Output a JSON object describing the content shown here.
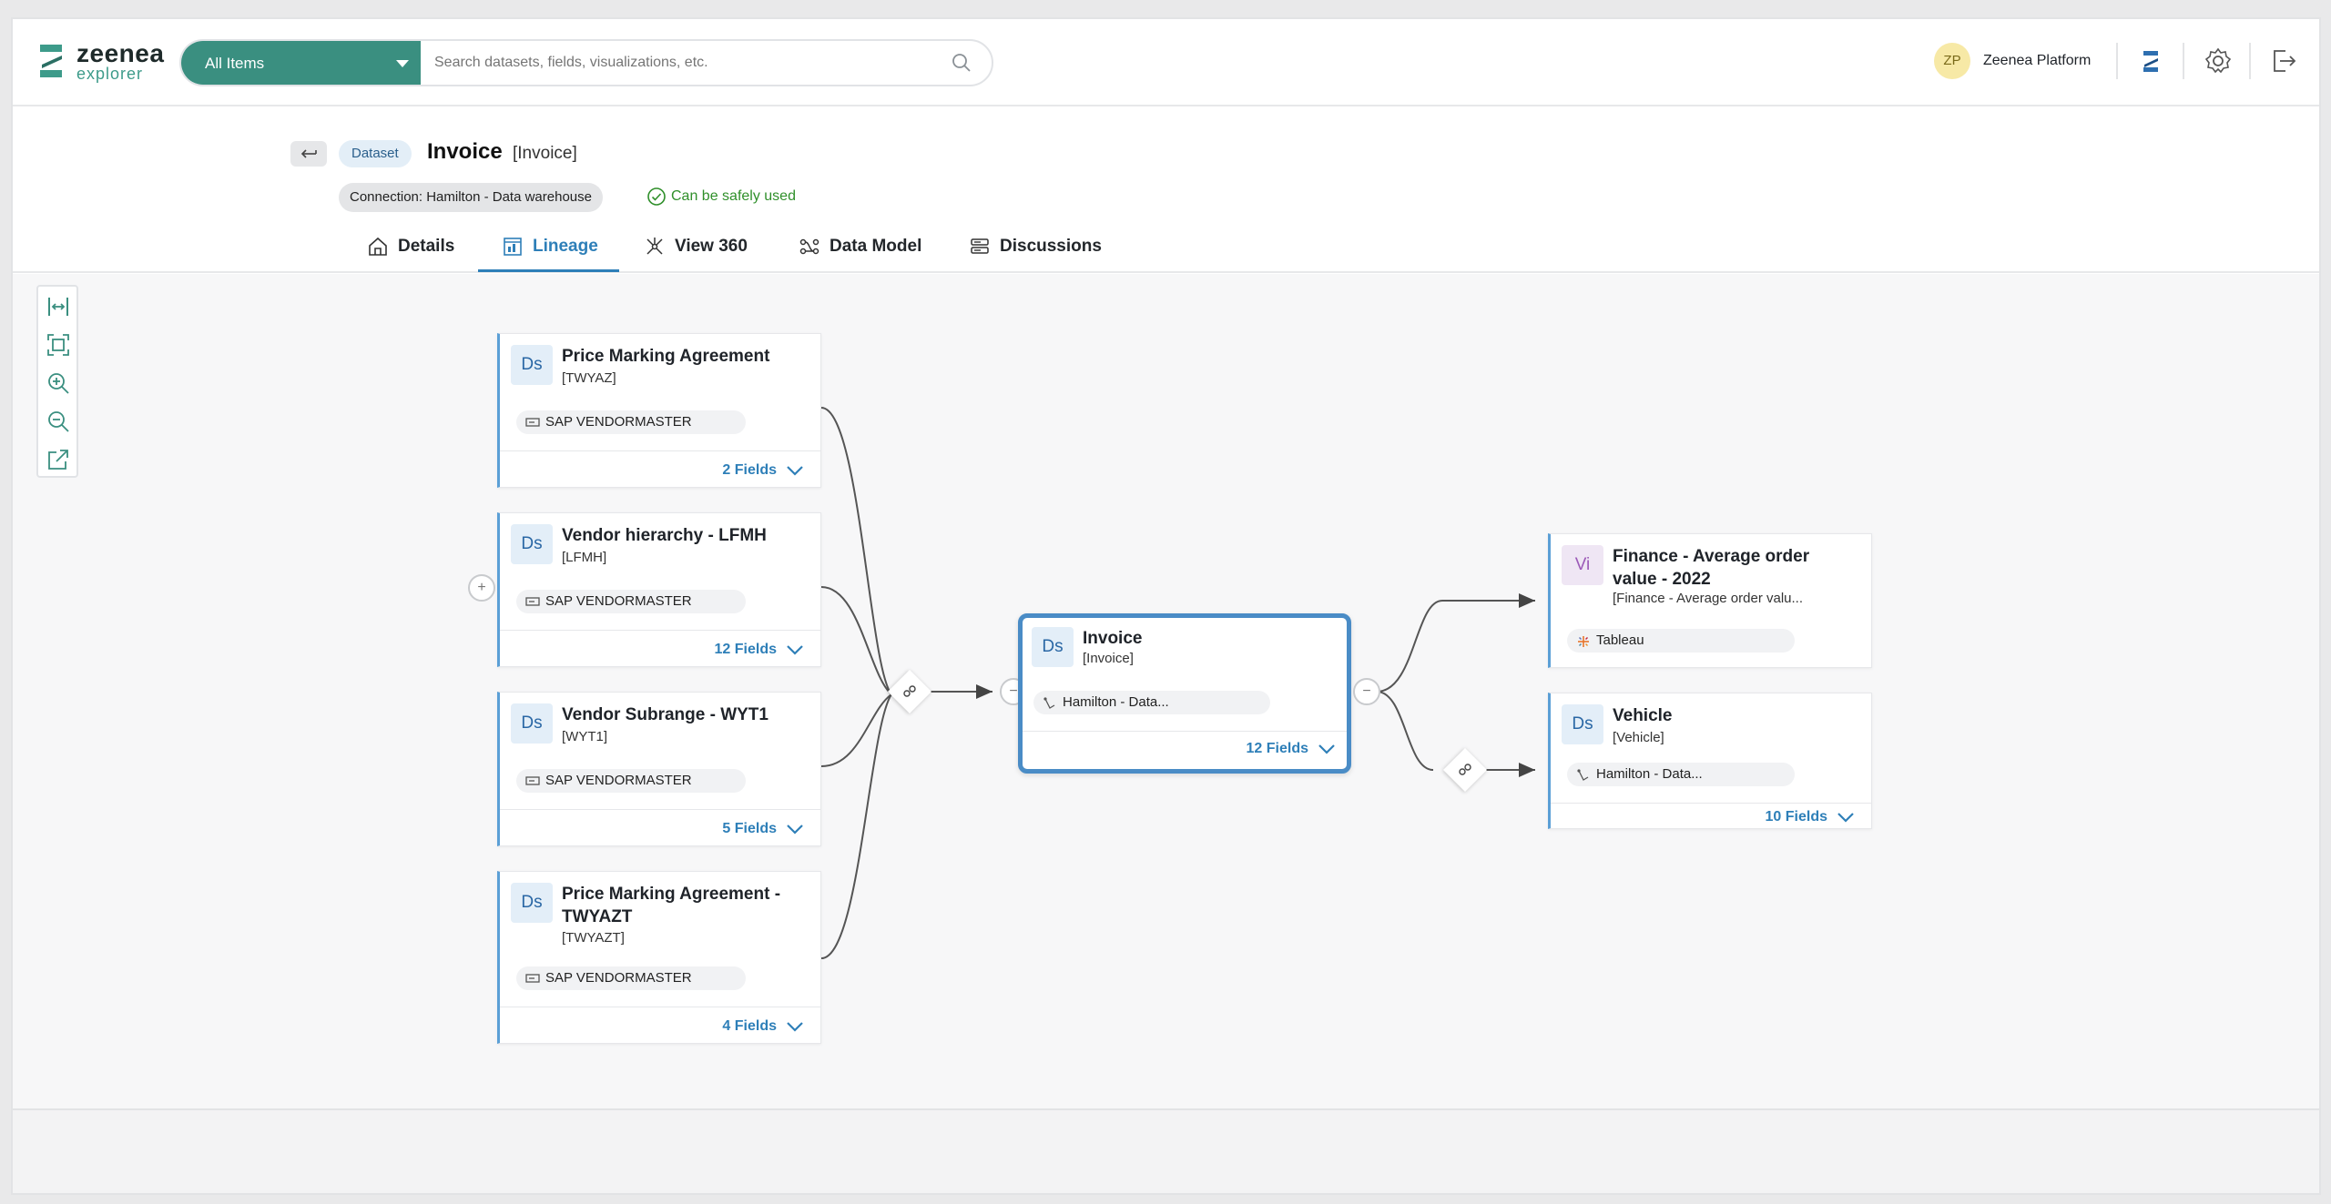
{
  "app": {
    "logo_primary": "zeenea",
    "logo_secondary": "explorer",
    "brand_color": "#3a8f80",
    "accent_color": "#2e7fb8"
  },
  "search": {
    "scope": "All Items",
    "placeholder": "Search datasets, fields, visualizations, etc."
  },
  "user": {
    "initials": "ZP",
    "name": "Zeenea Platform"
  },
  "toolbar_icons": [
    "zeenea-studio-icon",
    "settings-icon",
    "logout-icon"
  ],
  "header": {
    "type_chip": "Dataset",
    "title": "Invoice",
    "subtitle": "[Invoice]",
    "connection": "Connection: Hamilton - Data warehouse",
    "status": "Can be safely used"
  },
  "tabs": [
    {
      "label": "Details",
      "icon": "home-icon"
    },
    {
      "label": "Lineage",
      "icon": "lineage-icon",
      "active": true
    },
    {
      "label": "View 360",
      "icon": "view360-icon"
    },
    {
      "label": "Data Model",
      "icon": "data-model-icon"
    },
    {
      "label": "Discussions",
      "icon": "discussions-icon"
    }
  ],
  "zoom_controls": [
    "fit-width-icon",
    "fit-screen-icon",
    "zoom-in-icon",
    "zoom-out-icon",
    "export-icon"
  ],
  "lineage": {
    "upstream": [
      {
        "badge": "Ds",
        "name": "Price Marking Agreement",
        "tech": "[TWYAZ]",
        "source": "SAP VENDORMASTER",
        "fields": "2 Fields"
      },
      {
        "badge": "Ds",
        "name": "Vendor hierarchy - LFMH",
        "tech": "[LFMH]",
        "source": "SAP VENDORMASTER",
        "fields": "12 Fields"
      },
      {
        "badge": "Ds",
        "name": "Vendor Subrange - WYT1",
        "tech": "[WYT1]",
        "source": "SAP VENDORMASTER",
        "fields": "5 Fields"
      },
      {
        "badge": "Ds",
        "name": "Price Marking Agreement - TWYAZT",
        "tech": "[TWYAZT]",
        "source": "SAP VENDORMASTER",
        "fields": "4 Fields"
      }
    ],
    "center": {
      "badge": "Ds",
      "name": "Invoice",
      "tech": "[Invoice]",
      "source": "Hamilton - Data...",
      "fields": "12 Fields"
    },
    "downstream": [
      {
        "badge": "Vi",
        "name": "Finance - Average order value - 2022",
        "tech": "[Finance - Average order valu...",
        "source": "Tableau"
      },
      {
        "badge": "Ds",
        "name": "Vehicle",
        "tech": "[Vehicle]",
        "source": "Hamilton - Data...",
        "fields": "10 Fields"
      }
    ],
    "expand_symbol": "+",
    "collapse_symbol": "−"
  }
}
